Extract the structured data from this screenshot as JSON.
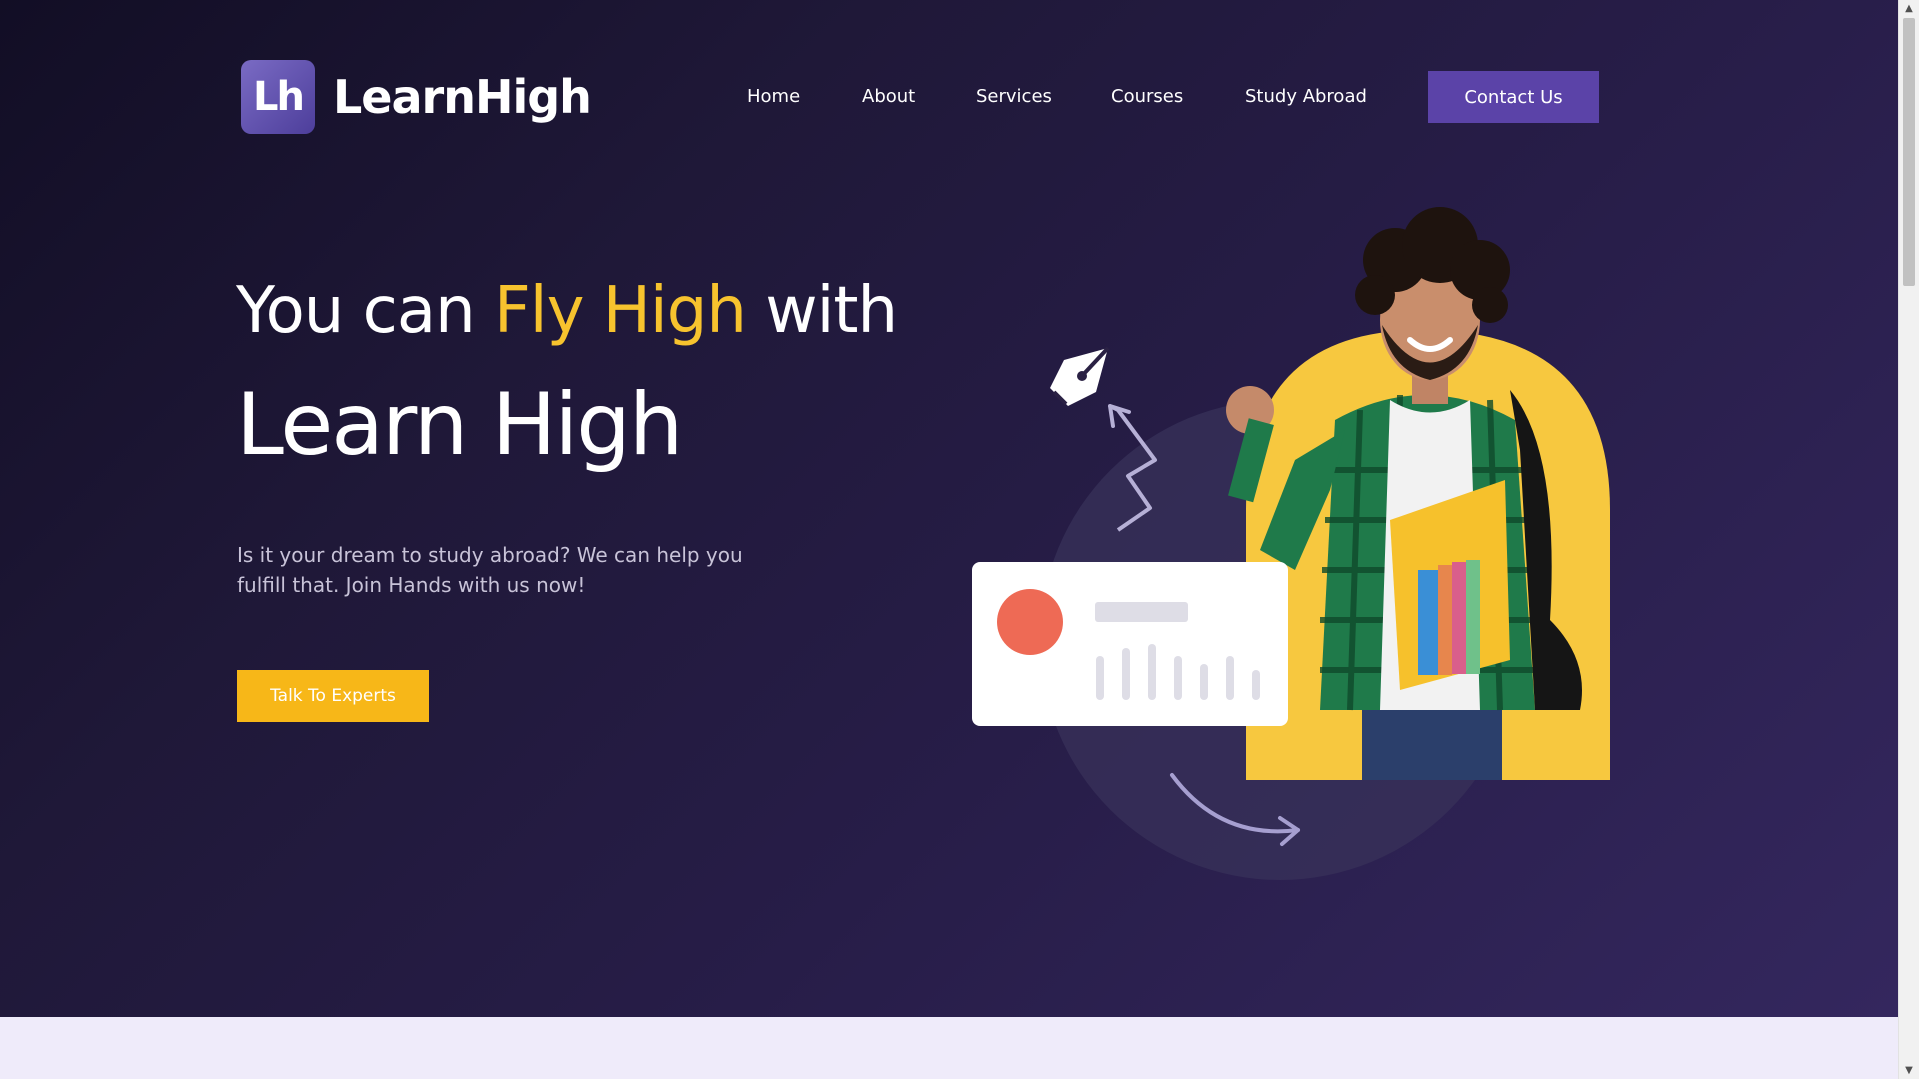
{
  "brand": {
    "logo_initials": "Lh",
    "name": "LearnHigh"
  },
  "nav": {
    "items": [
      {
        "label": "Home"
      },
      {
        "label": "About"
      },
      {
        "label": "Services"
      },
      {
        "label": "Courses"
      },
      {
        "label": "Study Abroad"
      }
    ],
    "contact_label": "Contact Us"
  },
  "hero": {
    "headline_prefix": "You can ",
    "headline_accent": "Fly High",
    "headline_suffix": " with",
    "headline_second_line": "Learn High",
    "lead": "Is it your dream to study abroad? We can help you fulfill that. Join Hands with us now!",
    "cta_label": "Talk To Experts"
  },
  "colors": {
    "accent_yellow": "#f7c32e",
    "button_yellow": "#f7b718",
    "brand_purple": "#5b43a8",
    "hero_dark": "#1f1838"
  },
  "icons": {
    "pen_nib": "pen-nib-icon",
    "scroll_up": "chevron-up-icon",
    "scroll_down": "chevron-down-icon"
  }
}
